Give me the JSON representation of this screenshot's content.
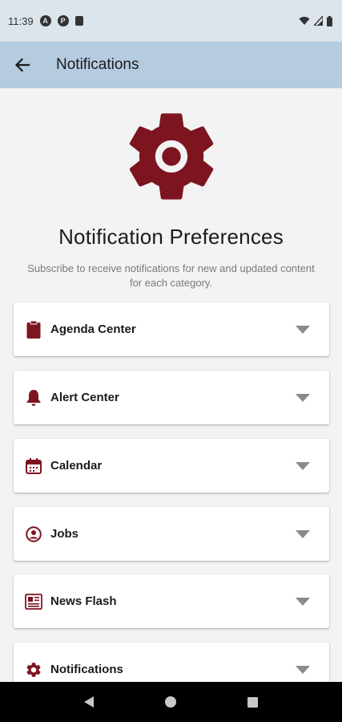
{
  "status_bar": {
    "time": "11:39",
    "left_icons": [
      "a-icon",
      "p-icon",
      "sd-card-icon"
    ],
    "right_icons": [
      "wifi-icon",
      "signal-icon",
      "battery-icon"
    ]
  },
  "app_bar": {
    "title": "Notifications",
    "back_icon": "arrow-left-icon"
  },
  "page": {
    "heading": "Notification Preferences",
    "subtext": "Subscribe to receive notifications for new and updated content for each category."
  },
  "categories": [
    {
      "label": "Agenda Center",
      "icon": "clipboard-icon"
    },
    {
      "label": "Alert Center",
      "icon": "bell-icon"
    },
    {
      "label": "Calendar",
      "icon": "calendar-icon"
    },
    {
      "label": "Jobs",
      "icon": "person-circle-icon"
    },
    {
      "label": "News Flash",
      "icon": "newspaper-icon"
    },
    {
      "label": "Notifications",
      "icon": "gear-icon"
    }
  ],
  "colors": {
    "accent": "#7d1521",
    "app_bar": "#b4cbe0",
    "status_bar": "#dce4ec",
    "background": "#f3f3f3",
    "chevron": "#8a8a8a"
  }
}
